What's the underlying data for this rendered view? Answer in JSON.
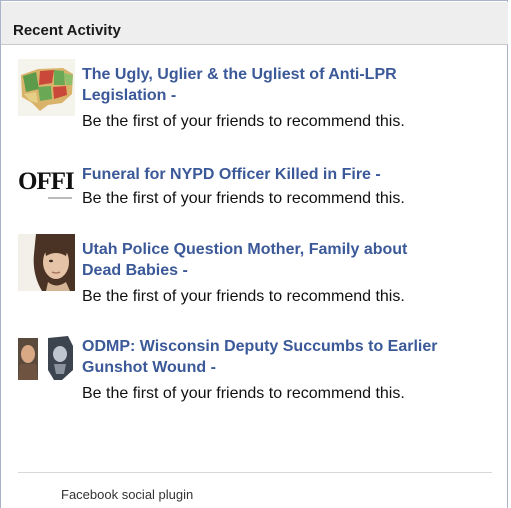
{
  "widget": {
    "title": "Recent Activity",
    "footer": "Facebook social plugin"
  },
  "items": [
    {
      "title_line1": "The Ugly, Uglier & the Ugliest of Anti-LPR",
      "title_line2": "Legislation -",
      "subtext": "Be the first of your friends to recommend this.",
      "thumb": "us-map-thumbnail"
    },
    {
      "title_line1": "Funeral for NYPD Officer Killed in Fire -",
      "subtext": "Be the first of your friends to recommend this.",
      "thumb": "newspaper-logo-thumbnail",
      "thumb_text": "OFFI"
    },
    {
      "title_line1": "Utah Police Question Mother, Family about",
      "title_line2": "Dead Babies -",
      "subtext": "Be the first of your friends to recommend this.",
      "thumb": "woman-portrait-thumbnail"
    },
    {
      "title_line1": "ODMP: Wisconsin Deputy Succumbs to Earlier",
      "title_line2": "Gunshot Wound -",
      "subtext": "Be the first of your friends to recommend this.",
      "thumb": "officer-badge-thumbnail"
    }
  ]
}
